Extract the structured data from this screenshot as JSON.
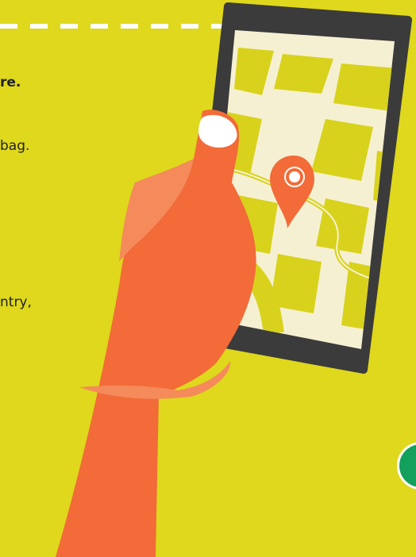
{
  "text": {
    "line_1": "re.",
    "line_2": "bag.",
    "line_3": "ntry,"
  },
  "colors": {
    "background": "#dfd81c",
    "hand": "#f26b38",
    "hand_highlight": "#f58a5a",
    "phone_body": "#3b3b3b",
    "map_base": "#f6f0d2",
    "map_blocks": "#d8d21c",
    "pin": "#f26b38",
    "nail": "#ffffff",
    "button": "#12a05c"
  },
  "icons": {
    "map_pin": "map-pin-icon",
    "action_button": "circle-button"
  }
}
